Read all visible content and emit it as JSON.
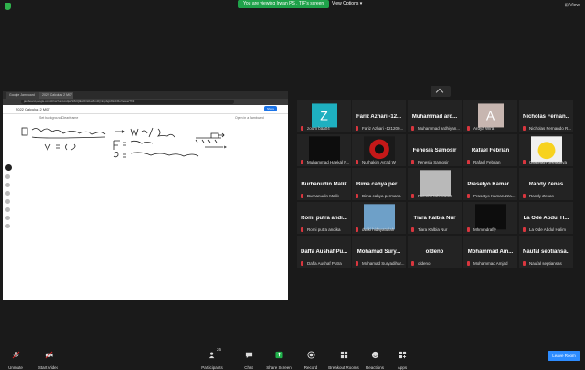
{
  "banner": {
    "viewing": "You are viewing Irwan PS . TIF's screen",
    "view_options": "View Options",
    "view": "View"
  },
  "shared_screen": {
    "tabs": [
      "Google Jamboard",
      "2022 Calculus 2 M07 - Googl"
    ],
    "url": "jamboard.google.com/d/1wYfunkcs0pwSl6zQkEc6rlHGwZm3QKtnpbgkbWdn5o/viewer?f=3",
    "jam_title": "2022 Calculus 2 M07",
    "share_label": "Share",
    "toolbar": [
      "Set background",
      "Clear frame"
    ],
    "open_laptop": "Open in a Jamboard",
    "colors": {
      "accent": "#1a73e8"
    }
  },
  "participants": [
    {
      "name": "",
      "label": "zoom baa04",
      "avatar": "Z",
      "avatar_color": "#1eb0c0"
    },
    {
      "name": "Fariz Azhari -12...",
      "label": "Fariz Azhari -121200..."
    },
    {
      "name": "Muhammad ard...",
      "label": "Muhammad ardhiyan..."
    },
    {
      "name": "",
      "label": "Ardya Wira",
      "avatar": "A",
      "avatar_color": "#c7b6b0"
    },
    {
      "name": "Nicholas Fernan...",
      "label": "Nicholas Fernando R..."
    },
    {
      "name": "",
      "label": "Muhammad Haekal F...",
      "photo": "dark"
    },
    {
      "name": "",
      "label": "Nurhakim As'ad W",
      "photo": "red"
    },
    {
      "name": "Fenesia Samosir",
      "label": "Fenesia Samosir"
    },
    {
      "name": "Rafael Febrian",
      "label": "Rafael Febrian"
    },
    {
      "name": "",
      "label": "Gilaghazi Dishaditya",
      "photo": "yellow"
    },
    {
      "name": "Burhanudin Malik",
      "label": "Burhanudin Malik"
    },
    {
      "name": "Bima cahya per...",
      "label": "Bima cahya permana"
    },
    {
      "name": "",
      "label": "Fazrah Rahmawati",
      "photo": "gray"
    },
    {
      "name": "Prasetyo Kamar...",
      "label": "Prasetyo Kamaruzza..."
    },
    {
      "name": "Randy Zenas",
      "label": "Randy Zenas"
    },
    {
      "name": "Romi putra andi...",
      "label": "Romi putra andika"
    },
    {
      "name": "",
      "label": "dwiki hidayatullah",
      "photo": "blue"
    },
    {
      "name": "Tiara Kalbia Nur",
      "label": "Tiara Kalbia Nur"
    },
    {
      "name": "",
      "label": "Mhmmdrafly",
      "photo": "dark"
    },
    {
      "name": "La Ode Abdul H...",
      "label": "La Ode Abdul Halim"
    },
    {
      "name": "Daffa Aushaf Pu...",
      "label": "Daffa Aushaf Putra"
    },
    {
      "name": "Mohamad Sury...",
      "label": "Mohamad Suryadihar..."
    },
    {
      "name": "oldeno",
      "label": "oldeno"
    },
    {
      "name": "Mohammad Am...",
      "label": "Mohammad Amjad"
    },
    {
      "name": "Naufal septiansa...",
      "label": "Naufal septiansas"
    }
  ],
  "toolbar": {
    "unmute": "Unmute",
    "start_video": "Start Video",
    "participants": "Participants",
    "participant_count": "26",
    "chat": "Chat",
    "share_screen": "Share Screen",
    "record": "Record",
    "breakout": "Breakout Rooms",
    "reactions": "Reactions",
    "apps": "Apps",
    "leave": "Leave Room"
  }
}
